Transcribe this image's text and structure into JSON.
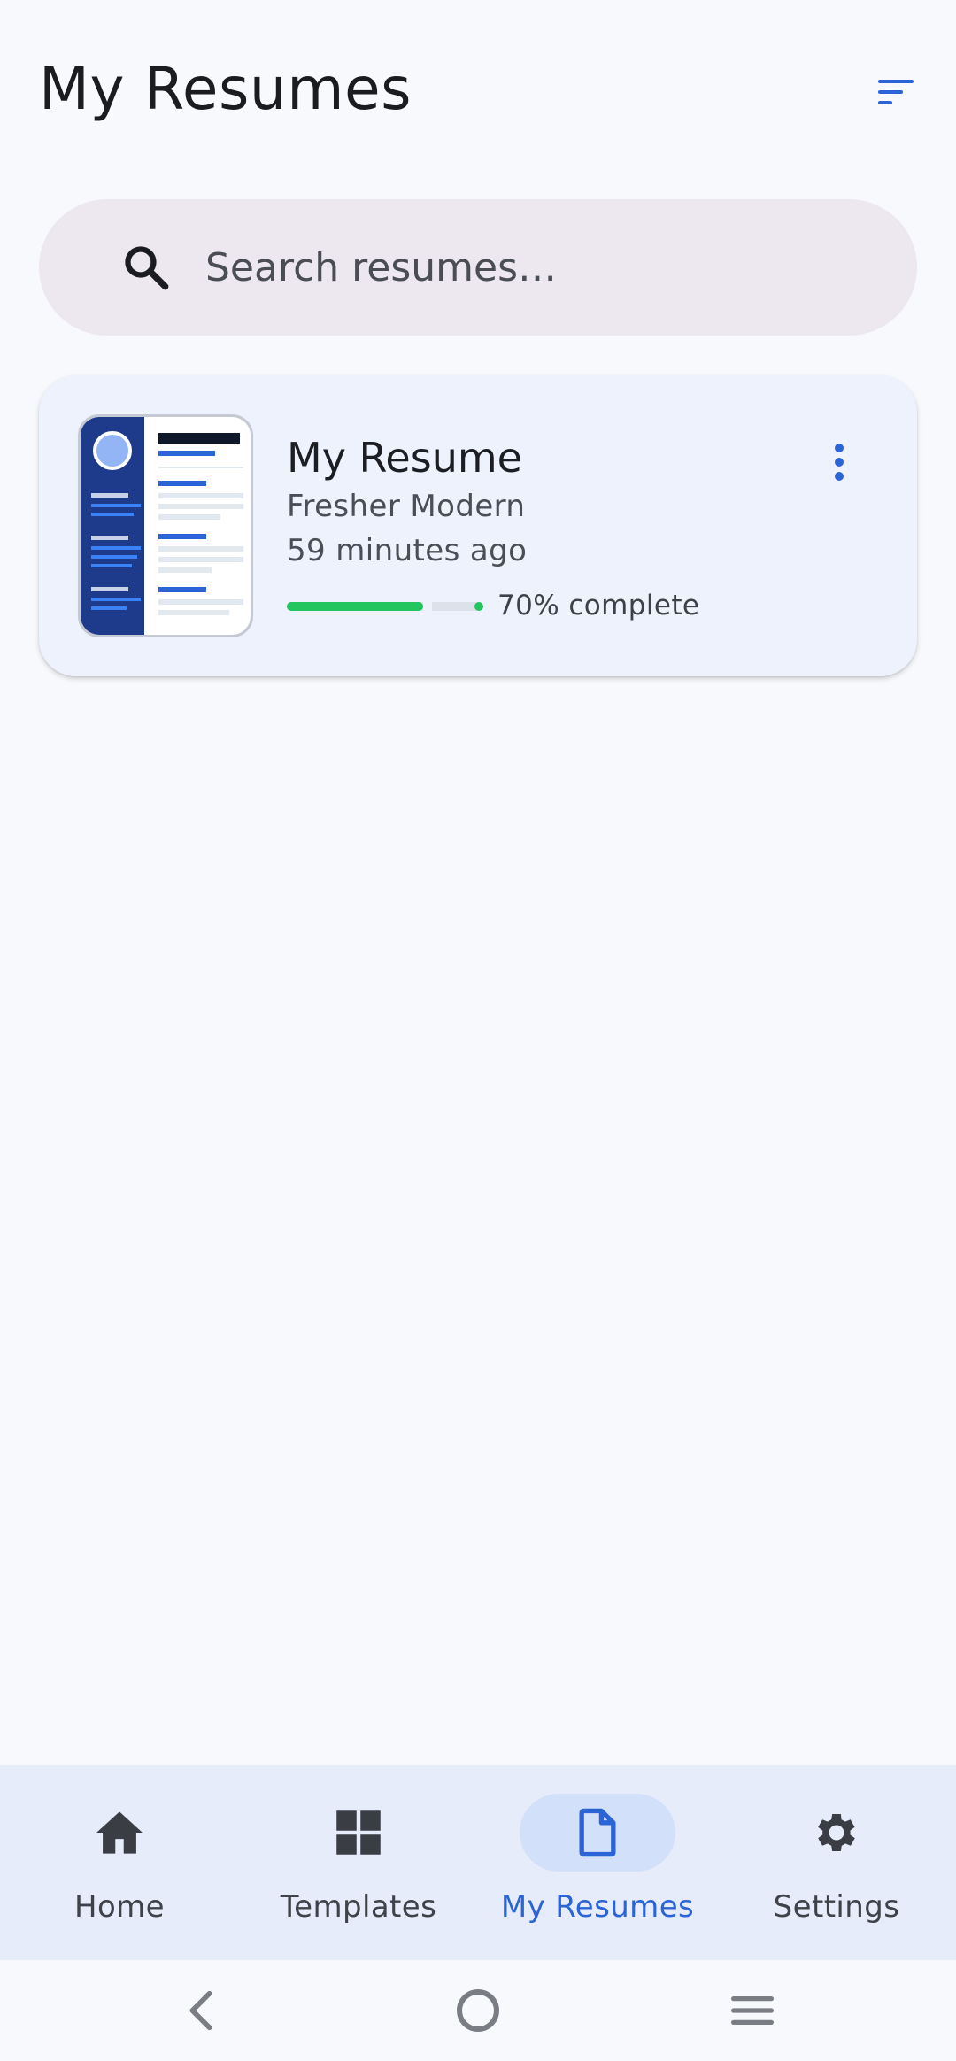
{
  "header": {
    "title": "My Resumes",
    "sort_icon": "sort-icon"
  },
  "search": {
    "placeholder": "Search resumes…",
    "value": "",
    "icon": "search-icon"
  },
  "resumes": [
    {
      "title": "My Resume",
      "template": "Fresher Modern",
      "updated": "59 minutes ago",
      "progress_percent": 70,
      "progress_label": "70% complete",
      "menu_icon": "more-vert-icon"
    }
  ],
  "bottom_nav": {
    "items": [
      {
        "label": "Home",
        "icon": "home-icon",
        "active": false
      },
      {
        "label": "Templates",
        "icon": "grid-icon",
        "active": false
      },
      {
        "label": "My Resumes",
        "icon": "document-icon",
        "active": true
      },
      {
        "label": "Settings",
        "icon": "gear-icon",
        "active": false
      }
    ]
  },
  "system_nav": {
    "back_icon": "back-icon",
    "home_icon": "circle-home-icon",
    "recents_icon": "menu-lines-icon"
  },
  "colors": {
    "accent": "#2b64d6",
    "progress": "#22c55e",
    "card_bg": "#edf2fd",
    "search_bg": "#ede7ef",
    "nav_bg": "#e6ecfa"
  }
}
